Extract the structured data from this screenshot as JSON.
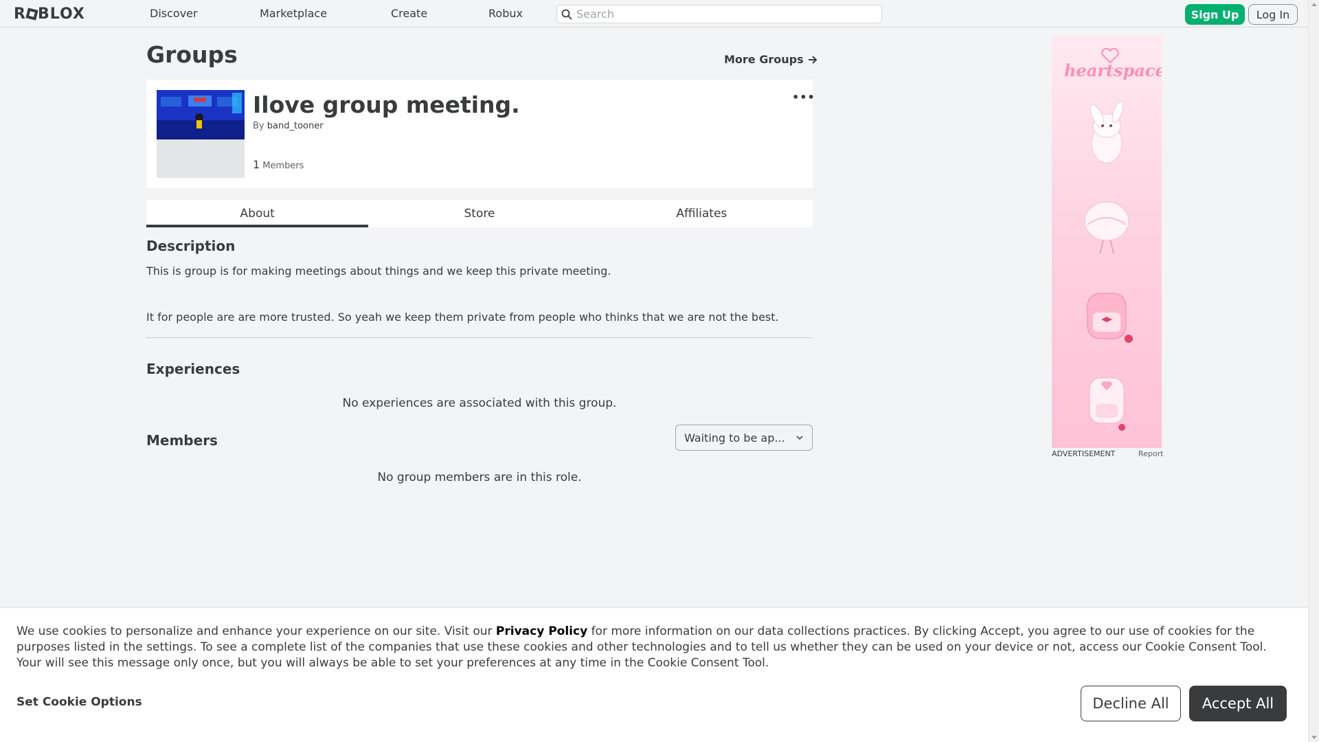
{
  "header": {
    "logo_text_a": "R",
    "logo_text_b": "BLOX",
    "nav": [
      "Discover",
      "Marketplace",
      "Create",
      "Robux"
    ],
    "search_placeholder": "Search",
    "sign_up": "Sign Up",
    "log_in": "Log In"
  },
  "page": {
    "title": "Groups",
    "more_groups": "More Groups"
  },
  "group": {
    "name": "Ilove group meeting.",
    "by_prefix": "By",
    "owner": "band_tooner",
    "member_count": "1",
    "members_label": "Members",
    "more_menu": "•••"
  },
  "tabs": [
    "About",
    "Store",
    "Affiliates"
  ],
  "about": {
    "description_heading": "Description",
    "description_line1": "This is group is for making meetings about things and we keep this private meeting.",
    "description_line2": "It for people are are more trusted. So yeah we keep them private from people who thinks that we are not the best.",
    "experiences_heading": "Experiences",
    "experiences_empty": "No experiences are associated with this group.",
    "members_heading": "Members",
    "role_selected": "Waiting to be ap...",
    "members_empty": "No group members are in this role."
  },
  "ad": {
    "brand": "heartspace",
    "label": "ADVERTISEMENT",
    "report": "Report"
  },
  "cookie": {
    "text_before": "We use cookies to personalize and enhance your experience on our site. Visit our ",
    "privacy_policy": "Privacy Policy",
    "text_after": " for more information on our data collections practices. By clicking Accept, you agree to our use of cookies for the purposes listed in the settings. To see a complete list of the companies that use these cookies and other technologies and to tell us whether they can be used on your device or not, access our Cookie Consent Tool. Your will see this message only once, but you will always be able to set your preferences at any time in the Cookie Consent Tool.",
    "set_options": "Set Cookie Options",
    "decline": "Decline All",
    "accept": "Accept All"
  },
  "colors": {
    "accent_green": "#00b06f",
    "text_dark": "#393b3d",
    "background": "#f2f4f5",
    "ad_pink": "#ffd1e0"
  }
}
